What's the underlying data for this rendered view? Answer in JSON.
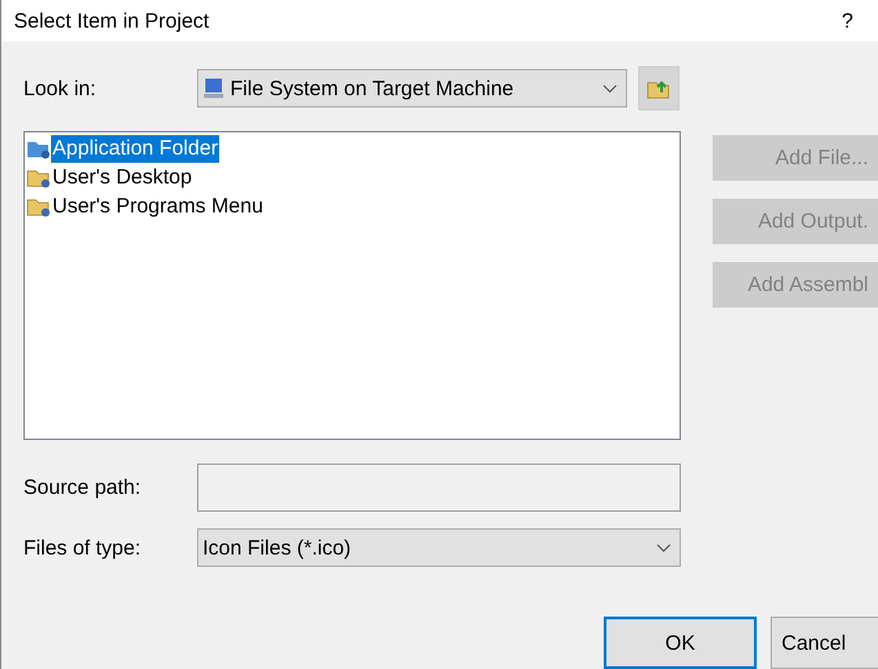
{
  "window": {
    "title": "Select Item in Project",
    "help": "?"
  },
  "look_in": {
    "label": "Look in:",
    "value": "File System on Target Machine"
  },
  "folders": [
    {
      "label": "Application Folder",
      "selected": true,
      "kind": "app"
    },
    {
      "label": "User's Desktop",
      "selected": false,
      "kind": "folder"
    },
    {
      "label": "User's Programs Menu",
      "selected": false,
      "kind": "folder"
    }
  ],
  "side_buttons": [
    {
      "label": "Add File...",
      "disabled": true
    },
    {
      "label": "Add Output.",
      "disabled": true
    },
    {
      "label": "Add Assembl",
      "disabled": true
    }
  ],
  "source_path": {
    "label": "Source path:"
  },
  "files_of_type": {
    "label": "Files of type:",
    "value": "Icon Files (*.ico)"
  },
  "buttons": [
    {
      "label": "OK",
      "default": true
    },
    {
      "label": "Cancel",
      "default": false
    }
  ]
}
